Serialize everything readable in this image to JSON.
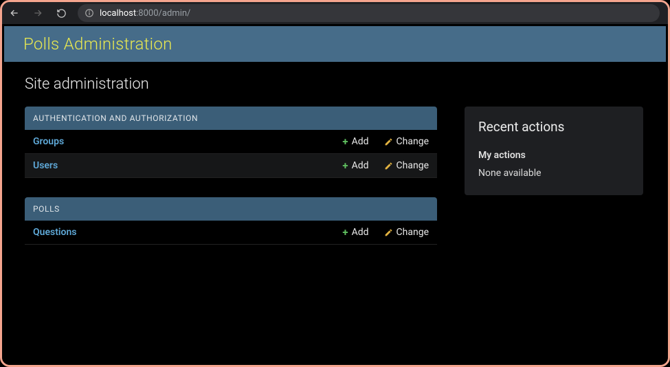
{
  "browser": {
    "url_host": "localhost",
    "url_rest": ":8000/admin/"
  },
  "header": {
    "title": "Polls Administration"
  },
  "page": {
    "title": "Site administration"
  },
  "labels": {
    "add": "Add",
    "change": "Change"
  },
  "modules": [
    {
      "name": "AUTHENTICATION AND AUTHORIZATION",
      "models": [
        {
          "label": "Groups"
        },
        {
          "label": "Users"
        }
      ]
    },
    {
      "name": "POLLS",
      "models": [
        {
          "label": "Questions"
        }
      ]
    }
  ],
  "recent": {
    "title": "Recent actions",
    "subtitle": "My actions",
    "empty": "None available"
  }
}
